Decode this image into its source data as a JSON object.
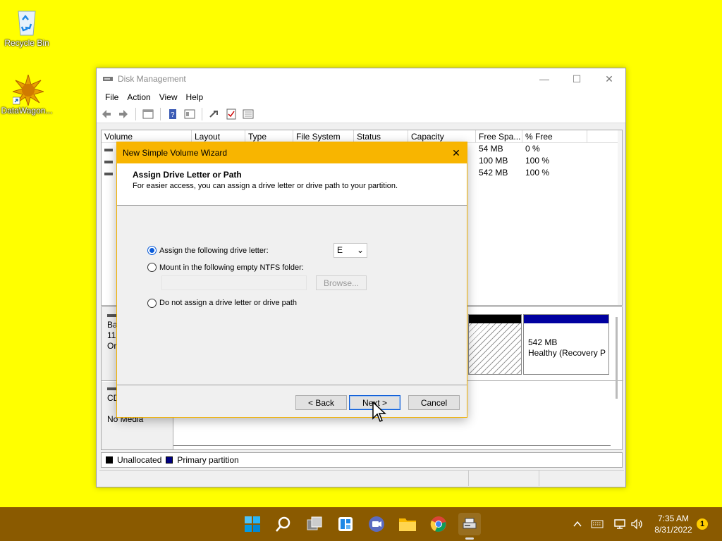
{
  "desktop": {
    "icons": [
      {
        "label": "Recycle Bin"
      },
      {
        "label": "DataWagon..."
      }
    ]
  },
  "window": {
    "title": "Disk Management",
    "menu": [
      "File",
      "Action",
      "View",
      "Help"
    ],
    "columns": [
      "Volume",
      "Layout",
      "Type",
      "File System",
      "Status",
      "Capacity",
      "Free Spa...",
      "% Free"
    ],
    "rows": [
      {
        "free": "54 MB",
        "pct": "0 %"
      },
      {
        "free": "100 MB",
        "pct": "100 %"
      },
      {
        "free": "542 MB",
        "pct": "100 %"
      }
    ],
    "disks": {
      "disk0_label_lines": [
        "Ba",
        "11!",
        "Or"
      ],
      "recovery_size": "542 MB",
      "recovery_status": "Healthy (Recovery P",
      "cd_label": "CD",
      "cd_media": "No Media"
    },
    "legend": [
      {
        "label": "Unallocated",
        "color": "#000000"
      },
      {
        "label": "Primary partition",
        "color": "#000080"
      }
    ]
  },
  "wizard": {
    "title": "New Simple Volume Wizard",
    "heading": "Assign Drive Letter or Path",
    "subheading": "For easier access, you can assign a drive letter or drive path to your partition.",
    "option_assign": "Assign the following drive letter:",
    "drive_letter": "E",
    "option_mount": "Mount in the following empty NTFS folder:",
    "browse_label": "Browse...",
    "option_none": "Do not assign a drive letter or drive path",
    "back_label": "< Back",
    "next_label": "Next >",
    "cancel_label": "Cancel"
  },
  "taskbar": {
    "time": "7:35 AM",
    "date": "8/31/2022",
    "notifications": "1"
  },
  "colors": {
    "desktop": "#ffff00",
    "accent": "#f8b500",
    "taskbar": "#8a5a00"
  }
}
